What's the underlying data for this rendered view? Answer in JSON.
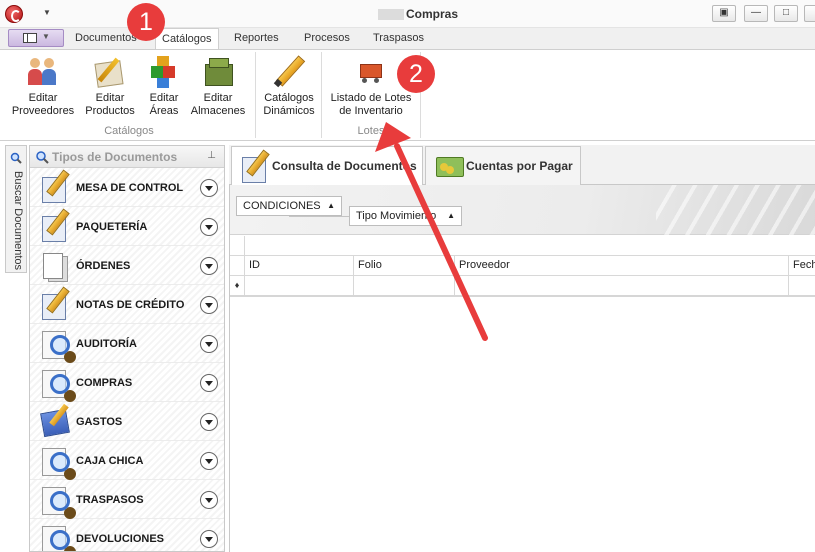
{
  "window": {
    "title": "Compras"
  },
  "ribbon_tabs": [
    {
      "label": "Documentos"
    },
    {
      "label": "Catálogos"
    },
    {
      "label": "Reportes"
    },
    {
      "label": "Procesos"
    },
    {
      "label": "Traspasos"
    }
  ],
  "ribbon": {
    "catalogos_group": {
      "label": "Catálogos",
      "buttons": [
        {
          "line1": "Editar",
          "line2": "Proveedores",
          "icon": "suppliers-icon"
        },
        {
          "line1": "Editar",
          "line2": "Productos",
          "icon": "products-icon"
        },
        {
          "line1": "Editar",
          "line2": "Áreas",
          "icon": "areas-icon"
        },
        {
          "line1": "Editar",
          "line2": "Almacenes",
          "icon": "warehouses-icon"
        }
      ]
    },
    "dinamicos_button": {
      "line1": "Catálogos",
      "line2": "Dinámicos",
      "icon": "pencil-icon"
    },
    "lotes_group": {
      "label": "Lotes",
      "button": {
        "line1": "Listado de Lotes",
        "line2": "de Inventario",
        "icon": "cart-icon"
      }
    }
  },
  "annotations": {
    "badge1": "1",
    "badge2": "2",
    "color": "#e83c3c"
  },
  "sidebar": {
    "side_tab": "Buscar Documentos",
    "title": "Tipos de Documentos",
    "items": [
      {
        "label": "MESA DE CONTROL",
        "icon": "doc-pencil-icon"
      },
      {
        "label": "PAQUETERÍA",
        "icon": "doc-pencil-icon"
      },
      {
        "label": "ÓRDENES",
        "icon": "sheets-icon"
      },
      {
        "label": "NOTAS DE CRÉDITO",
        "icon": "doc-pencil-icon"
      },
      {
        "label": "AUDITORÍA",
        "icon": "magnifier-icon"
      },
      {
        "label": "COMPRAS",
        "icon": "magnifier-icon"
      },
      {
        "label": "GASTOS",
        "icon": "blue-doc-pencil-icon"
      },
      {
        "label": "CAJA CHICA",
        "icon": "magnifier-icon"
      },
      {
        "label": "TRASPASOS",
        "icon": "magnifier-icon"
      },
      {
        "label": "DEVOLUCIONES",
        "icon": "magnifier-icon"
      }
    ]
  },
  "main_tabs": [
    {
      "label": "Consulta de Documentos",
      "icon": "doc-pencil-icon"
    },
    {
      "label": "Cuentas por Pagar",
      "icon": "money-icon"
    }
  ],
  "grouping": {
    "chip1": "CONDICIONES",
    "chip2": "Tipo Movimiento"
  },
  "grid": {
    "columns": [
      "ID",
      "Folio",
      "Proveedor",
      "Fech"
    ]
  }
}
